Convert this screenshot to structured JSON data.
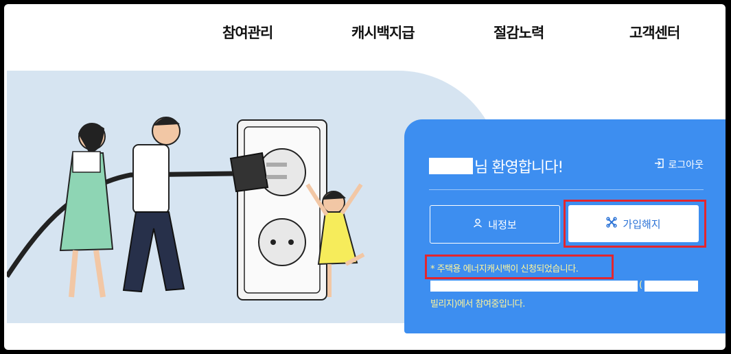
{
  "nav": {
    "items": [
      "참여관리",
      "캐시백지급",
      "절감노력",
      "고객센터"
    ]
  },
  "panel": {
    "welcome_suffix": "님 환영합니다!",
    "logout_label": "로그아웃",
    "my_info_label": "내정보",
    "withdraw_label": "가입해지",
    "notice_line1": "* 주택용 에너지캐시백이 신청되었습니다.",
    "notice_paren": "(",
    "notice_line2": "빌리지)에서 참여중입니다."
  },
  "colors": {
    "panel": "#3d8ef0",
    "notice_text": "#fff59a",
    "highlight": "#e3262e"
  },
  "icons": [
    "logout-icon",
    "user-icon",
    "withdraw-icon"
  ]
}
